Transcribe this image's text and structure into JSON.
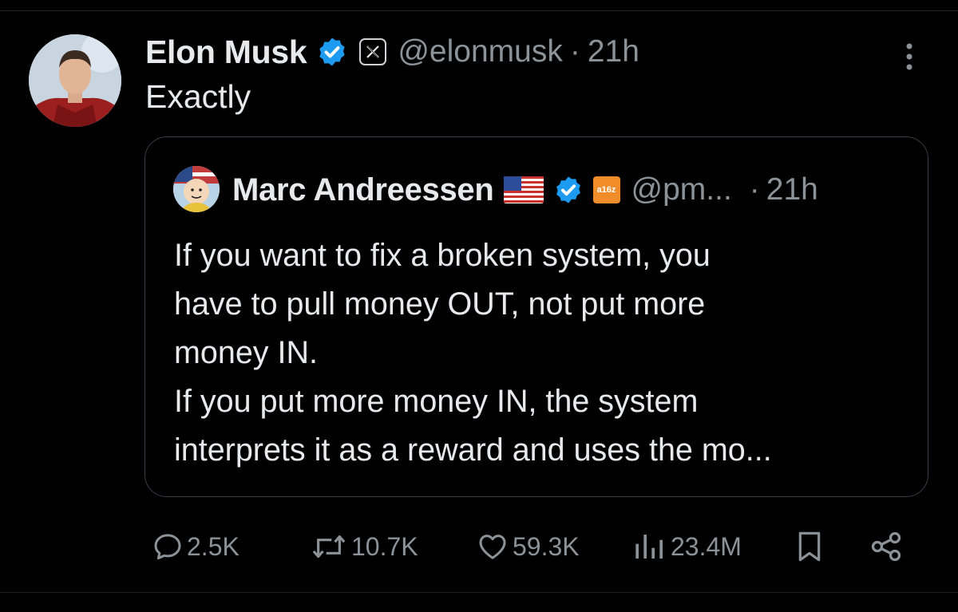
{
  "post": {
    "author_name": "Elon Musk",
    "handle": "@elonmusk",
    "separator": "·",
    "time": "21h",
    "text": "Exactly"
  },
  "quote": {
    "author_name": "Marc Andreessen",
    "badge_text": "a16z",
    "handle": "@pm...",
    "separator": "·",
    "time": "21h",
    "lines": [
      "If you want to fix a broken system, you",
      "have to pull money OUT, not put more",
      "money IN.",
      "If you put more money IN, the system",
      "interprets it as a reward and uses the mo..."
    ]
  },
  "actions": {
    "replies": "2.5K",
    "reposts": "10.7K",
    "likes": "59.3K",
    "views": "23.4M"
  },
  "colors": {
    "background": "#000000",
    "text": "#e7e9ea",
    "secondary": "#8b9298",
    "verified": "#1d9bf0",
    "border": "#3a3d41"
  }
}
